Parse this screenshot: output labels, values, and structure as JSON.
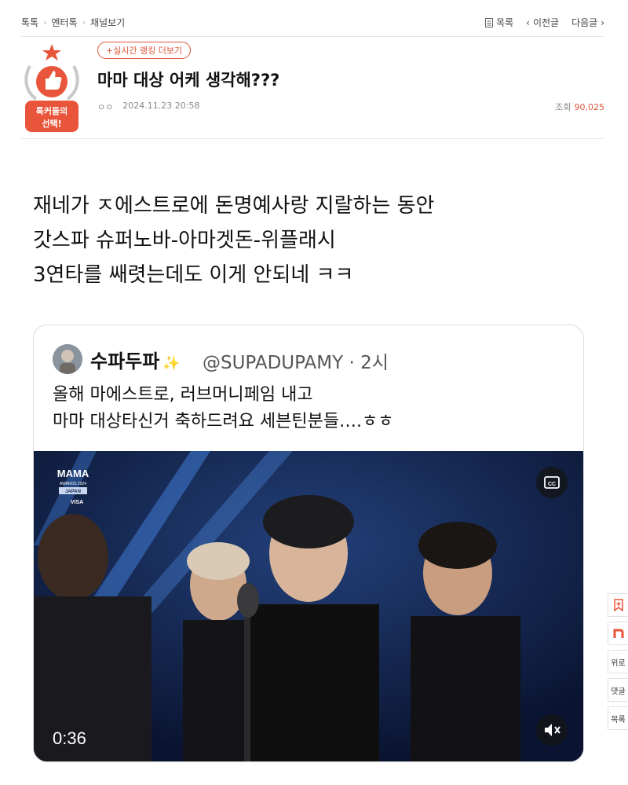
{
  "breadcrumb": [
    "톡톡",
    "엔터톡",
    "채널보기"
  ],
  "nav": {
    "list": "목록",
    "prev": "이전글",
    "next": "다음글"
  },
  "badge": {
    "line1": "톡커들의",
    "line2": "선택!"
  },
  "post": {
    "live_ranking": "+실시간 랭킹 더보기",
    "title": "마마 대상 어케 생각해???",
    "author": "ㅇㅇ",
    "date": "2024.11.23 20:58",
    "views_label": "조회",
    "views": "90,025"
  },
  "body": [
    "재네가 ㅈ에스트로에 돈명예사랑 지랄하는 동안",
    "갓스파 슈퍼노바-아마겟돈-위플래시",
    "3연타를 쌔렷는데도 이게 안되네 ㅋㅋ"
  ],
  "tweet": {
    "name": "수파두파",
    "handle": "@SUPADUPAMY · 2시",
    "lines": [
      "올해 마에스트로, 러브머니페임 내고",
      "마마 대상타신거 축하드려요 세븐틴분들….ㅎㅎ"
    ],
    "video": {
      "logo": "MAMA",
      "logo_sub1": "AWARDS 2024",
      "logo_sub2": "JAPAN",
      "sponsor": "VISA",
      "duration": "0:36",
      "cc": "CC"
    }
  },
  "sidebar": {
    "reply": "위로",
    "comment": "댓글",
    "list": "목록"
  },
  "colors": {
    "accent": "#e0563b",
    "badge_red": "#e9553a",
    "video_bg": "#0d1a3a"
  }
}
